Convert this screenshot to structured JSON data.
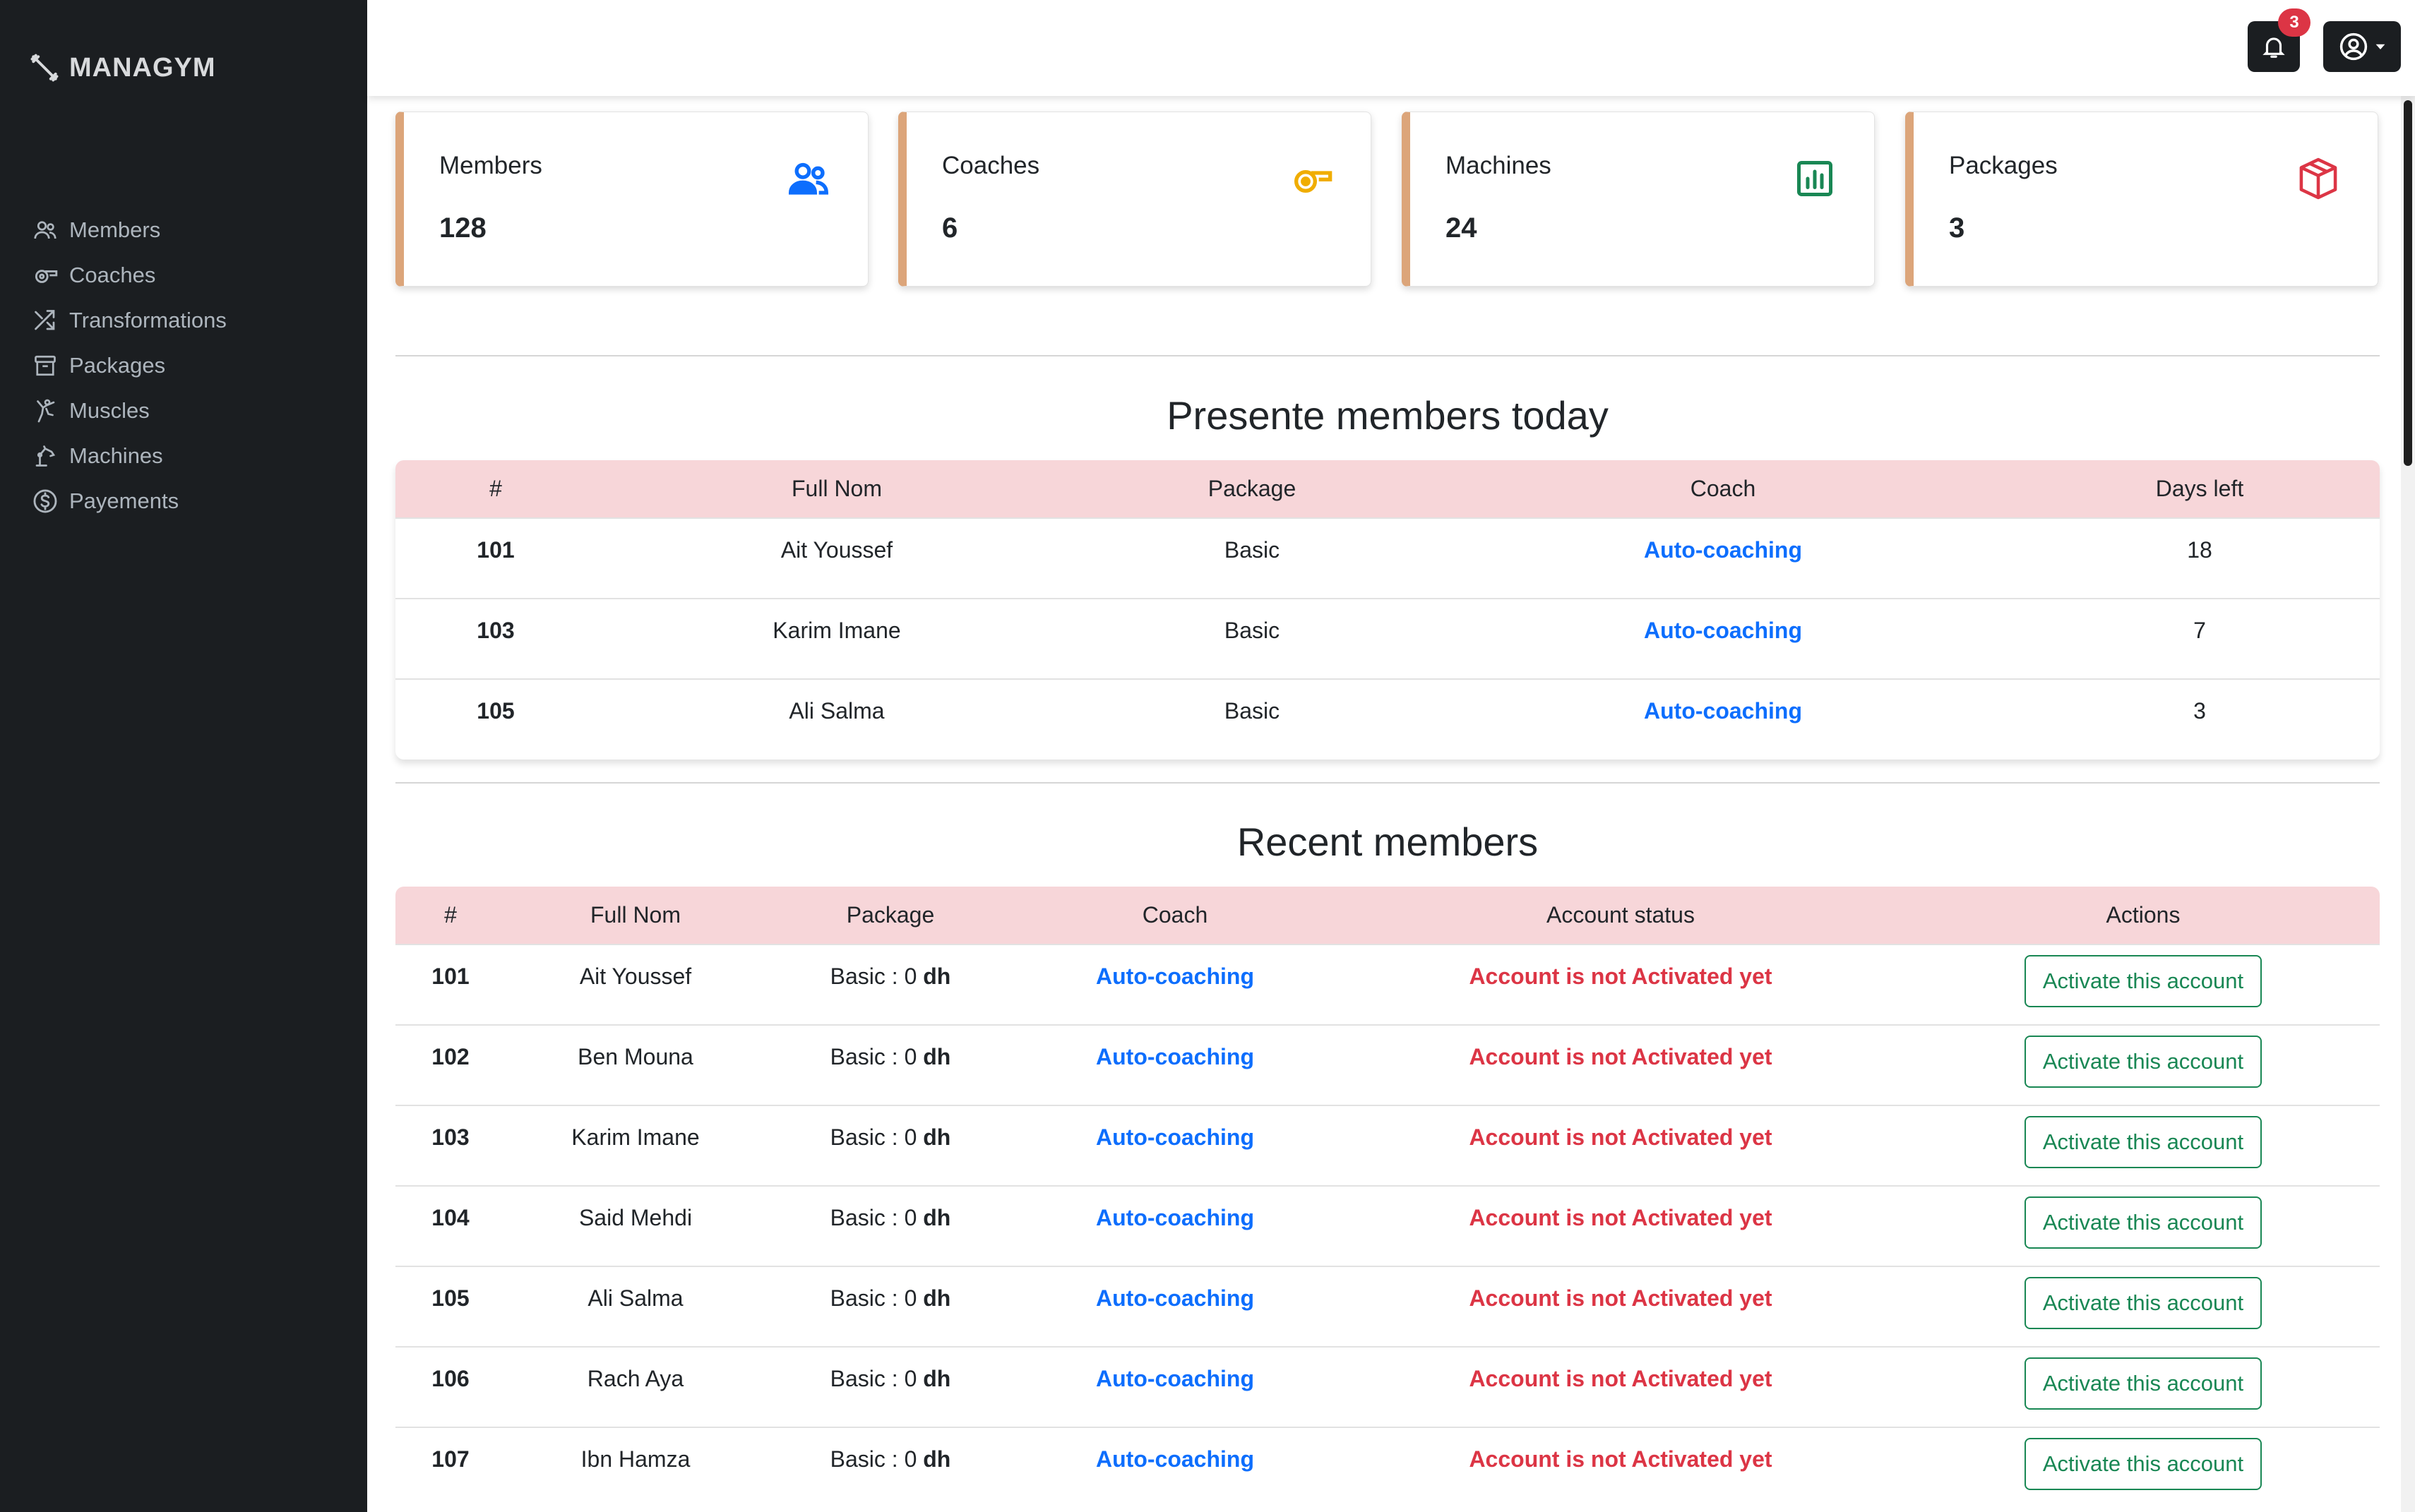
{
  "app": {
    "brand": "MANAGYM"
  },
  "sidebar": {
    "items": [
      {
        "label": "Members",
        "icon": "people-icon"
      },
      {
        "label": "Coaches",
        "icon": "whistle-icon"
      },
      {
        "label": "Transformations",
        "icon": "shuffle-icon"
      },
      {
        "label": "Packages",
        "icon": "archive-icon"
      },
      {
        "label": "Muscles",
        "icon": "kick-icon"
      },
      {
        "label": "Machines",
        "icon": "machine-icon"
      },
      {
        "label": "Payements",
        "icon": "dollar-circle-icon"
      }
    ]
  },
  "topbar": {
    "notification_count": "3"
  },
  "stats": [
    {
      "label": "Members",
      "value": "128",
      "icon": "people-icon",
      "color": "#0d6efd"
    },
    {
      "label": "Coaches",
      "value": "6",
      "icon": "whistle-icon",
      "color": "#f0ad00"
    },
    {
      "label": "Machines",
      "value": "24",
      "icon": "bar-chart-icon",
      "color": "#198754"
    },
    {
      "label": "Packages",
      "value": "3",
      "icon": "box-icon",
      "color": "#dc3545"
    }
  ],
  "present": {
    "title": "Presente members today",
    "headers": [
      "#",
      "Full Nom",
      "Package",
      "Coach",
      "Days left"
    ],
    "rows": [
      {
        "id": "101",
        "name": "Ait Youssef",
        "package": "Basic",
        "coach": "Auto-coaching",
        "days_left": "18"
      },
      {
        "id": "103",
        "name": "Karim Imane",
        "package": "Basic",
        "coach": "Auto-coaching",
        "days_left": "7"
      },
      {
        "id": "105",
        "name": "Ali Salma",
        "package": "Basic",
        "coach": "Auto-coaching",
        "days_left": "3"
      }
    ]
  },
  "recent": {
    "title": "Recent members",
    "headers": [
      "#",
      "Full Nom",
      "Package",
      "Coach",
      "Account status",
      "Actions"
    ],
    "rows": [
      {
        "id": "101",
        "name": "Ait Youssef",
        "package": "Basic : 0",
        "currency": "dh",
        "coach": "Auto-coaching",
        "status": "Account is not Activated yet",
        "action": "Activate this account"
      },
      {
        "id": "102",
        "name": "Ben Mouna",
        "package": "Basic : 0",
        "currency": "dh",
        "coach": "Auto-coaching",
        "status": "Account is not Activated yet",
        "action": "Activate this account"
      },
      {
        "id": "103",
        "name": "Karim Imane",
        "package": "Basic : 0",
        "currency": "dh",
        "coach": "Auto-coaching",
        "status": "Account is not Activated yet",
        "action": "Activate this account"
      },
      {
        "id": "104",
        "name": "Said Mehdi",
        "package": "Basic : 0",
        "currency": "dh",
        "coach": "Auto-coaching",
        "status": "Account is not Activated yet",
        "action": "Activate this account"
      },
      {
        "id": "105",
        "name": "Ali Salma",
        "package": "Basic : 0",
        "currency": "dh",
        "coach": "Auto-coaching",
        "status": "Account is not Activated yet",
        "action": "Activate this account"
      },
      {
        "id": "106",
        "name": "Rach Aya",
        "package": "Basic : 0",
        "currency": "dh",
        "coach": "Auto-coaching",
        "status": "Account is not Activated yet",
        "action": "Activate this account"
      },
      {
        "id": "107",
        "name": "Ibn Hamza",
        "package": "Basic : 0",
        "currency": "dh",
        "coach": "Auto-coaching",
        "status": "Account is not Activated yet",
        "action": "Activate this account"
      }
    ]
  }
}
